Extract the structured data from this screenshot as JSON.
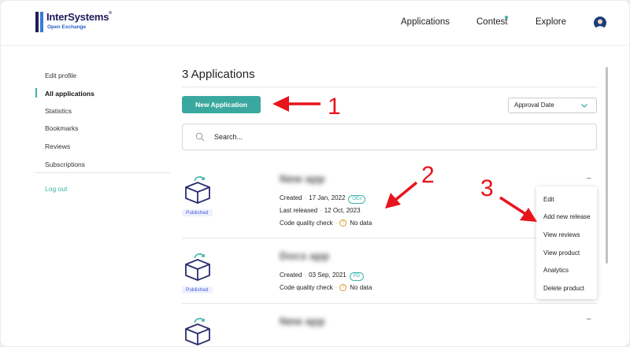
{
  "header": {
    "logo_name": "InterSystems",
    "logo_sub": "Open Exchange",
    "nav": {
      "applications": "Applications",
      "contest": "Contest",
      "explore": "Explore"
    }
  },
  "sidebar": {
    "items": [
      {
        "label": "Edit profile"
      },
      {
        "label": "All applications"
      },
      {
        "label": "Statistics"
      },
      {
        "label": "Bookmarks"
      },
      {
        "label": "Reviews"
      },
      {
        "label": "Subscriptions"
      }
    ],
    "logout": "Log out"
  },
  "main": {
    "title": "3 Applications",
    "new_app_label": "New Application",
    "sort_value": "Approval Date",
    "search_placeholder": "Search..."
  },
  "apps": [
    {
      "name": "New app",
      "status": "Published",
      "created_label": "Created",
      "created_date": "17 Jan, 2022",
      "tag": "OEx",
      "released_label": "Last released",
      "released_date": "12 Oct, 2023",
      "quality_label": "Code quality check",
      "quality_value": "No data",
      "menu_dots": "..."
    },
    {
      "name": "Docs app",
      "status": "Published",
      "created_label": "Created",
      "created_date": "03 Sep, 2021",
      "tag": "PD",
      "quality_label": "Code quality check",
      "quality_value": "No data"
    },
    {
      "name": "New app",
      "menu_dots": "..."
    }
  ],
  "context_menu": {
    "items": [
      "Edit",
      "Add new release",
      "View reviews",
      "View product",
      "Analytics",
      "Delete product"
    ]
  },
  "annotations": [
    "1",
    "2",
    "3"
  ],
  "colors": {
    "accent": "#3ba8a0",
    "annotation": "#e8141c",
    "brand": "#1e1a5c"
  }
}
